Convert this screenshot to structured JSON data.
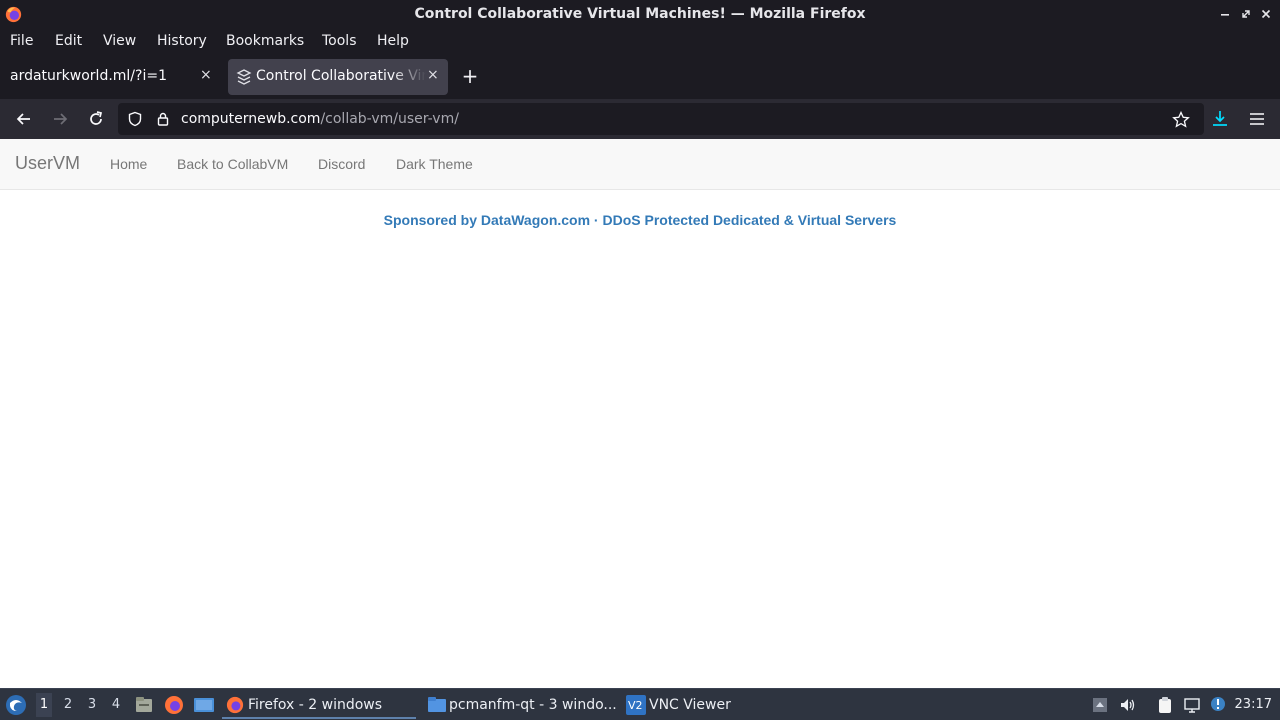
{
  "window": {
    "title": "Control Collaborative Virtual Machines! — Mozilla Firefox",
    "controls": [
      "minimize-icon",
      "maximize-icon",
      "close-icon"
    ]
  },
  "menubar": {
    "items": [
      "File",
      "Edit",
      "View",
      "History",
      "Bookmarks",
      "Tools",
      "Help"
    ]
  },
  "tabs": [
    {
      "label": "ardaturkworld.ml/?i=1",
      "active": false
    },
    {
      "label": "Control Collaborative Virtual Machines!",
      "active": true
    }
  ],
  "tab_close_glyph": "×",
  "new_tab_glyph": "+",
  "urlbar": {
    "domain": "computernewb.com",
    "path": "/collab-vm/user-vm/"
  },
  "site": {
    "brand": "UserVM",
    "links": [
      "Home",
      "Back to CollabVM",
      "Discord",
      "Dark Theme"
    ],
    "sponsor": "Sponsored by DataWagon.com · DDoS Protected Dedicated & Virtual Servers"
  },
  "taskbar": {
    "workspaces": [
      "1",
      "2",
      "3",
      "4"
    ],
    "active_workspace": "1",
    "tasks": [
      {
        "label": "Firefox - 2 windows",
        "icon": "firefox-icon",
        "active": true
      },
      {
        "label": "pcmanfm-qt - 3 windo...",
        "icon": "folder-icon",
        "active": false
      },
      {
        "label": "VNC Viewer",
        "icon": "vnc-icon",
        "active": false
      }
    ],
    "clock": "23:17"
  },
  "colors": {
    "chrome_dark": "#1c1b22",
    "active_tab": "#42414d",
    "link_blue": "#337ab7",
    "nav_gray": "#777777",
    "taskbar": "#2e3440"
  }
}
